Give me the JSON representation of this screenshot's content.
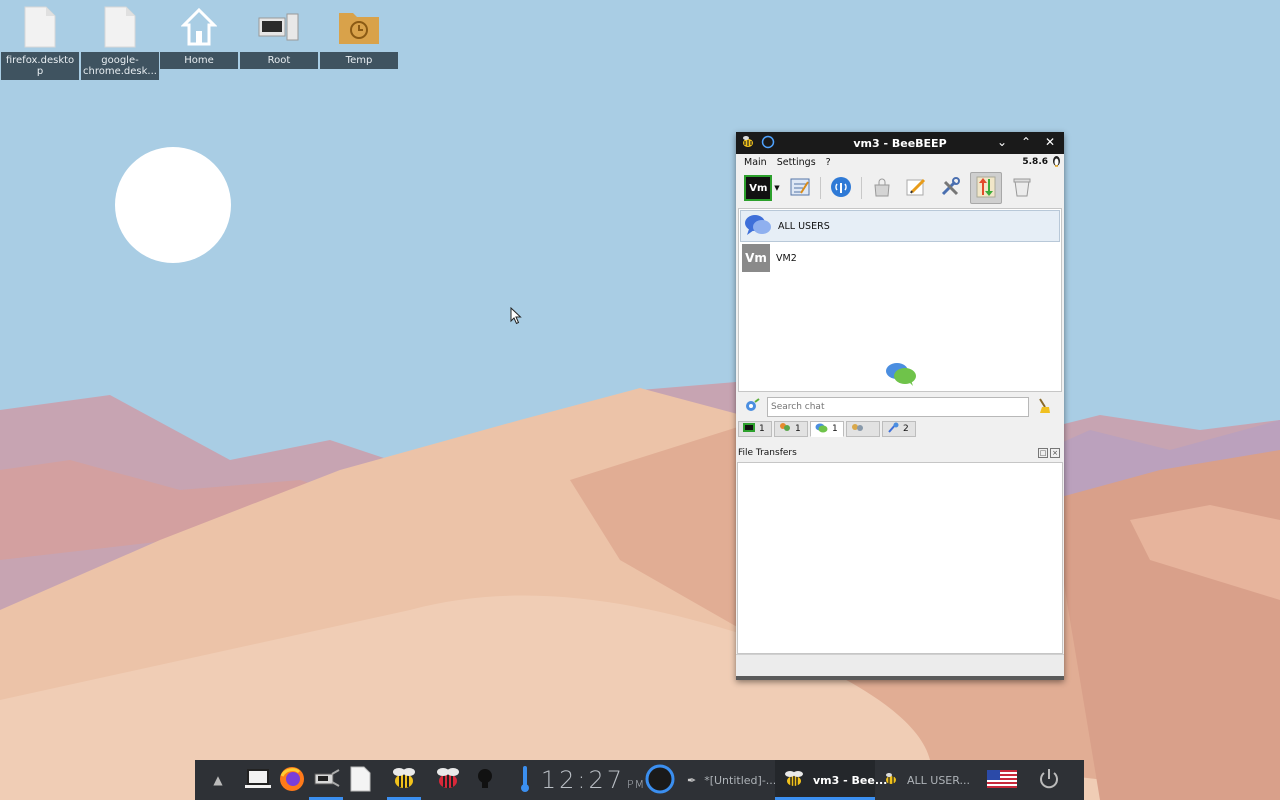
{
  "desktop": {
    "icons": [
      {
        "label": "firefox.desktop",
        "icon": "file-icon"
      },
      {
        "label": "google-chrome.desk...",
        "icon": "file-icon"
      },
      {
        "label": "Home",
        "icon": "home-icon"
      },
      {
        "label": "Root",
        "icon": "computer-icon"
      },
      {
        "label": "Temp",
        "icon": "folder-clock-icon"
      }
    ]
  },
  "window": {
    "title": "vm3 - BeeBEEP",
    "menu": [
      "Main",
      "Settings",
      "?"
    ],
    "version": "5.8.6",
    "toolbar": {
      "avatar_text": "Vm",
      "icons": [
        "profile-edit-icon",
        "broadcast-icon",
        "bag-icon",
        "pencil-icon",
        "tools-icon",
        "file-transfer-icon",
        "trash-icon"
      ]
    },
    "users": [
      {
        "name": "ALL USERS",
        "icon": "all-users-icon",
        "selected": true
      },
      {
        "name": "VM2",
        "avatar": "Vm",
        "selected": false
      }
    ],
    "search": {
      "placeholder": "Search chat"
    },
    "tabs": [
      {
        "icon": "users-tab-icon",
        "count": "1"
      },
      {
        "icon": "groups-tab-icon",
        "count": "1"
      },
      {
        "icon": "chats-tab-icon",
        "count": "1"
      },
      {
        "icon": "shared-tab-icon",
        "count": ""
      },
      {
        "icon": "network-tab-icon",
        "count": "2"
      }
    ],
    "file_transfers": {
      "label": "File Transfers"
    }
  },
  "taskbar": {
    "clock": {
      "time": "12:27",
      "ampm": "PM"
    },
    "tasks": [
      {
        "label": "*[Untitled]-...",
        "active": false
      },
      {
        "label": "vm3 - Bee...",
        "active": true
      },
      {
        "label": "ALL USER...",
        "active": false
      }
    ]
  },
  "colors": {
    "sky": "#a9cde4",
    "sand_light": "#ecc3a8",
    "sand_dark": "#d99f86",
    "taskbar": "#2e3136",
    "accent": "#3b8ff0"
  }
}
